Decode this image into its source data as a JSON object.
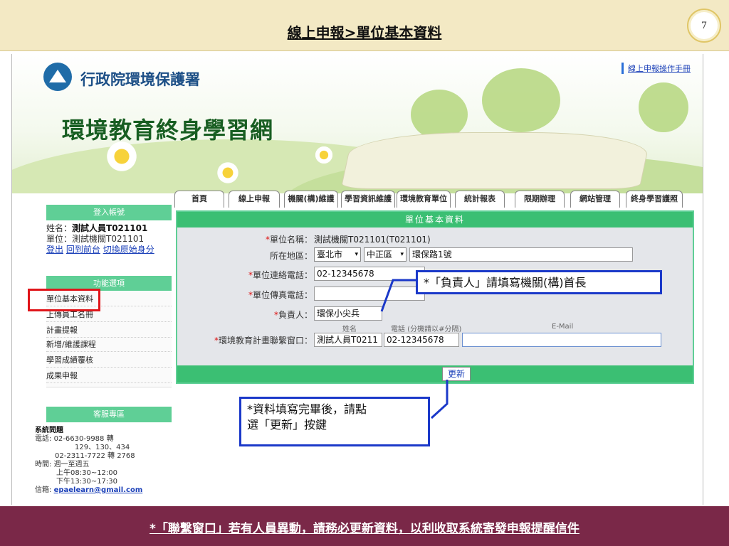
{
  "slide": {
    "title": "線上申報>單位基本資料",
    "page_number": "7",
    "bottom_note": "*「聯繫窗口」若有人員異動，請務必更新資料，以利收取系統寄發申報提醒信件"
  },
  "site": {
    "agency": "行政院環境保護署",
    "name": "環境教育終身學習網",
    "manual_link": "線上申報操作手冊"
  },
  "nav": {
    "tabs": [
      "首頁",
      "線上申報",
      "機關(構)維護",
      "學習資訊維護",
      "環境教育單位",
      "統計報表",
      "限期辦理",
      "網站管理",
      "終身學習護照"
    ]
  },
  "sidebar": {
    "login_header": "登入帳號",
    "name_label": "姓名：",
    "name_value": "測試人員T021101",
    "unit_label": "單位：",
    "unit_value": "測試機關T021101",
    "links": [
      "登出",
      "回到前台",
      "切換原始身分"
    ],
    "menu_header": "功能選項",
    "menu_items": [
      "單位基本資料",
      "上傳員工名冊",
      "計畫提報",
      "新增/維護課程",
      "學習成績覆核",
      "成果申報"
    ],
    "service_header": "客服專區",
    "service": {
      "title": "系統問題",
      "phone_label": "電話:",
      "phone1": "02-6630-9988 轉",
      "phone1_ext": "129、130、434",
      "phone2": "02-2311-7722 轉 2768",
      "time_label": "時間:",
      "days": "週一至週五",
      "am": "上午08:30~12:00",
      "pm": "下午13:30~17:30",
      "email_label": "信箱:",
      "email": "epaelearn@gmail.com"
    }
  },
  "form": {
    "header": "單位基本資料",
    "unit_name_label": "單位名稱：",
    "unit_name_value": "測試機關T021101(T021101)",
    "region_label": "所在地區：",
    "city": "臺北市",
    "district": "中正區",
    "address": "環保路1號",
    "phone_label": "單位連絡電話：",
    "phone_value": "02-12345678",
    "fax_label": "單位傳真電話：",
    "fax_value": "",
    "head_label": "負責人：",
    "head_value": "環保小尖兵",
    "contact_label": "環境教育計畫聯繫窗口：",
    "contact_name_hdr": "姓名",
    "contact_phone_hdr": "電話 (分機請以#分隔)",
    "contact_email_hdr": "E-Mail",
    "contact_name": "測試人員T0211",
    "contact_phone": "02-12345678",
    "contact_email": "",
    "update_button": "更新"
  },
  "callouts": {
    "head_note": "*「負責人」請填寫機關(構)首長",
    "update_note_line1": "*資料填寫完畢後，請點",
    "update_note_line2": "選「更新」按鍵"
  },
  "colors": {
    "accent_green": "#3bbf73",
    "callout_blue": "#1b39c9",
    "highlight_red": "#e0151a",
    "bottom_band": "#7a2848",
    "title_band": "#f3e9c4"
  }
}
